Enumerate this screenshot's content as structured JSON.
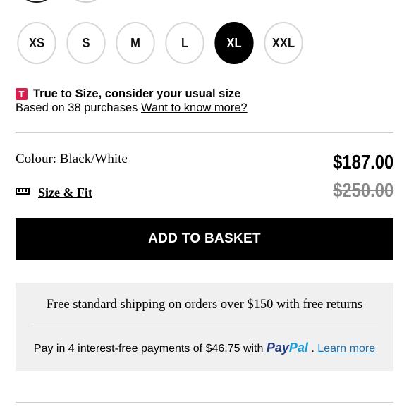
{
  "sizes": {
    "options": [
      "XS",
      "S",
      "M",
      "L",
      "XL",
      "XXL"
    ],
    "selected": "XL"
  },
  "fit": {
    "icon_letter": "T",
    "title": "True to Size, consider your usual size",
    "subtitle": "Based on 38 purchases",
    "link": "Want to know more?"
  },
  "product": {
    "colour_label": "Colour: Black/White",
    "price": "$187.00",
    "original_price": "$250.00",
    "size_fit_label": "Size & Fit"
  },
  "actions": {
    "add_to_basket": "ADD TO BASKET"
  },
  "info": {
    "shipping": "Free standard shipping on orders over $150 with free returns",
    "paypal_prefix": "Pay in 4 interest-free payments of $46.75 with",
    "paypal_brand_part1": "Pay",
    "paypal_brand_part2": "Pal",
    "paypal_separator": ".",
    "learn_more": "Learn more"
  },
  "colors": {
    "fit_badge": "#d6204f",
    "paypal_dark": "#253b80",
    "paypal_light": "#179bd7",
    "link_blue": "#1a6fb0"
  }
}
